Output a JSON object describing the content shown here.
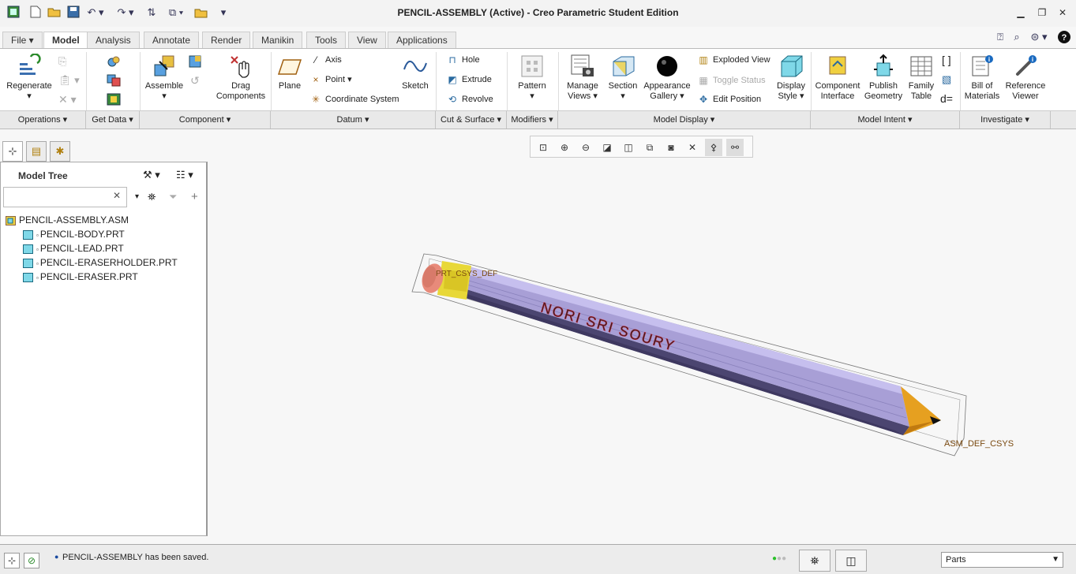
{
  "window": {
    "title": "PENCIL-ASSEMBLY (Active) - Creo Parametric Student Edition"
  },
  "tabs": [
    {
      "label": "File ▾"
    },
    {
      "label": "Model"
    },
    {
      "label": "Analysis"
    },
    {
      "label": "Annotate"
    },
    {
      "label": "Render"
    },
    {
      "label": "Manikin"
    },
    {
      "label": "Tools"
    },
    {
      "label": "View"
    },
    {
      "label": "Applications"
    }
  ],
  "ribbon": {
    "regenerate": "Regenerate",
    "assemble": "Assemble",
    "drag_components": [
      "Drag",
      "Components"
    ],
    "plane": "Plane",
    "axis": "Axis",
    "point": "Point",
    "coord_system": "Coordinate System",
    "sketch": "Sketch",
    "hole": "Hole",
    "extrude": "Extrude",
    "revolve": "Revolve",
    "pattern": "Pattern",
    "manage_views": [
      "Manage",
      "Views"
    ],
    "section": "Section",
    "appearance_gallery": [
      "Appearance",
      "Gallery"
    ],
    "exploded_view": "Exploded View",
    "toggle_status": "Toggle Status",
    "edit_position": "Edit Position",
    "display_style": [
      "Display",
      "Style"
    ],
    "component_interface": [
      "Component",
      "Interface"
    ],
    "publish_geometry": [
      "Publish",
      "Geometry"
    ],
    "family_table": [
      "Family",
      "Table"
    ],
    "bill_of_materials": [
      "Bill of",
      "Materials"
    ],
    "reference_viewer": [
      "Reference",
      "Viewer"
    ]
  },
  "groups": [
    {
      "label": "Operations"
    },
    {
      "label": "Get Data"
    },
    {
      "label": "Component"
    },
    {
      "label": "Datum"
    },
    {
      "label": "Cut & Surface"
    },
    {
      "label": "Modifiers"
    },
    {
      "label": "Model Display"
    },
    {
      "label": "Model Intent"
    },
    {
      "label": "Investigate"
    }
  ],
  "tree": {
    "header": "Model Tree",
    "search_value": "",
    "root": "PENCIL-ASSEMBLY.ASM",
    "items": [
      {
        "label": "PENCIL-BODY.PRT"
      },
      {
        "label": "PENCIL-LEAD.PRT"
      },
      {
        "label": "PENCIL-ERASERHOLDER.PRT"
      },
      {
        "label": "PENCIL-ERASER.PRT"
      }
    ]
  },
  "viewport": {
    "pencil_text": "NORI SRI SOURY",
    "csys_label": "ASM_DEF_CSYS",
    "part_csys_label": "PRT_CSYS_DEF",
    "colors": {
      "body": "#a89fd6",
      "body_dark": "#4b4570",
      "wood": "#e6a020",
      "eraser": "#e88a7a",
      "holder": "#e8d838"
    }
  },
  "status": {
    "message": "PENCIL-ASSEMBLY has been saved.",
    "filter_value": "Parts"
  }
}
